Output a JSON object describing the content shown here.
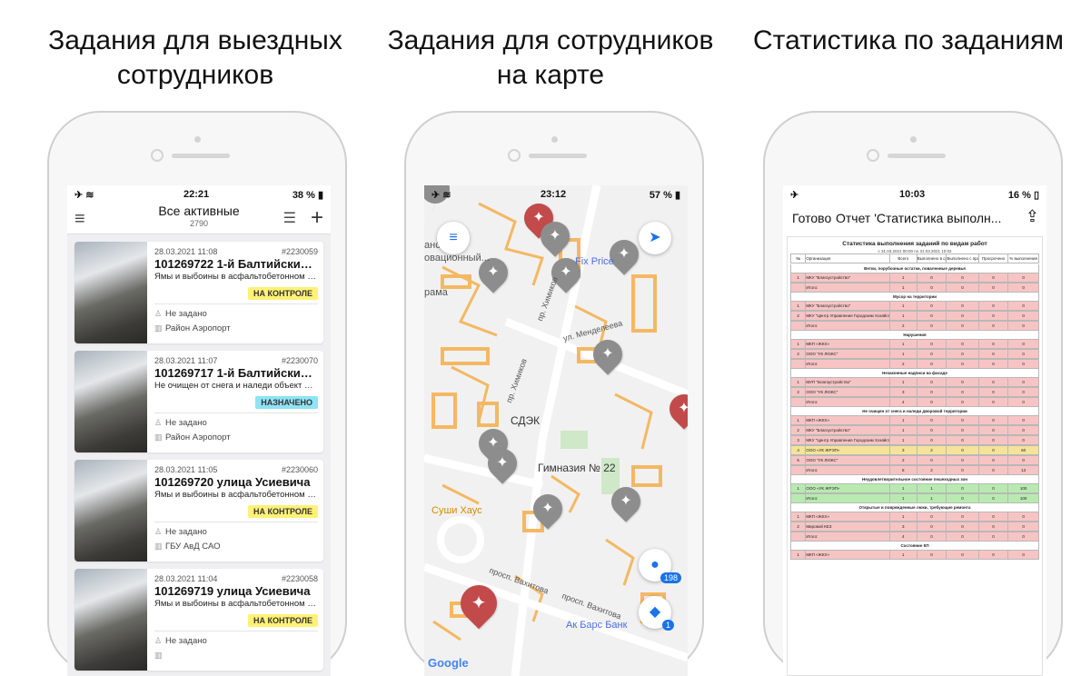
{
  "titles": {
    "left": "Задания для выездных сотрудников",
    "middle": "Задания для сотрудников на карте",
    "right": "Статистика по заданиям"
  },
  "phone1": {
    "status": {
      "time": "22:21",
      "battery": "38 %"
    },
    "header": {
      "title": "Все активные",
      "count": "2790"
    },
    "cards": [
      {
        "date": "28.03.2021 11:08",
        "number": "#2230059",
        "title": "101269722 1-й Балтийский п...",
        "desc": "Ямы и выбоины в асфальтобетонном по...",
        "badge": "НА КОНТРОЛЕ",
        "assignee": "Не задано",
        "district": "Район Аэропорт"
      },
      {
        "date": "28.03.2021 11:07",
        "number": "#2230070",
        "title": "101269717 1-й Балтийский пе...",
        "desc": "Не очищен от снега и наледи объект до...",
        "badge": "НАЗНАЧЕНО",
        "assignee": "Не задано",
        "district": "Район Аэропорт"
      },
      {
        "date": "28.03.2021 11:05",
        "number": "#2230060",
        "title": "101269720 улица Усиевича",
        "desc": "Ямы и выбоины в асфальтобетонном по...",
        "badge": "НА КОНТРОЛЕ",
        "assignee": "Не задано",
        "district": "ГБУ АвД САО"
      },
      {
        "date": "28.03.2021 11:04",
        "number": "#2230058",
        "title": "101269719 улица Усиевича",
        "desc": "Ямы и выбоины в асфальтобетонном по...",
        "badge": "НА КОНТРОЛЕ",
        "assignee": "Не задано",
        "district": ""
      }
    ],
    "colors": {
      "badge_control": "#fff176",
      "badge_assigned": "#8ee3f5"
    }
  },
  "phone2": {
    "status": {
      "time": "23:12",
      "battery": "57 %"
    },
    "labels": {
      "l1": "анс.",
      "l2": "овационный...",
      "l3": "рама",
      "l4": "Fix Price",
      "l5": "пр. Химиков",
      "l6": "ул. Менделеева",
      "l7": "пр. Химиков",
      "l8": "СДЭК",
      "l9": "Гимназия № 22",
      "l10": "Суши Хаус",
      "l11": "просп. Вахитова",
      "l12": "просп. Вахитова",
      "l13": "Ак Барс Банк",
      "google": "Google"
    },
    "counts": {
      "people": "198",
      "layers": "1"
    },
    "colors": {
      "pin_gray": "#8d8d8d",
      "pin_red": "#c24a4a",
      "road": "#f4b862",
      "accent": "#1a73e8"
    }
  },
  "phone3": {
    "status": {
      "time": "10:03",
      "battery": "16 %"
    },
    "header": {
      "done": "Готово",
      "title": "Отчет 'Статистика выполн..."
    },
    "doc": {
      "title": "Статистика выполнения заданий по видам работ",
      "period": "с 31.03.2021 00:00 по 31.03.2021 10:02",
      "columns": [
        "№",
        "Организация",
        "Всего",
        "Выполнено в срок",
        "Выполнено с просрочкой",
        "Просрочено",
        "% выполнения"
      ],
      "sections": [
        {
          "name": "Ветки, порубочные остатки, поваленные деревья",
          "color": "red",
          "rows": [
            [
              "1",
              "МКУ \"Благоустройство\"",
              "1",
              "0",
              "0",
              "0",
              "0"
            ],
            [
              "",
              "Итого:",
              "1",
              "0",
              "0",
              "0",
              "0"
            ]
          ]
        },
        {
          "name": "Мусор на территории",
          "color": "red",
          "rows": [
            [
              "1",
              "МКУ \"Благоустройство\"",
              "1",
              "0",
              "0",
              "0",
              "0"
            ],
            [
              "2",
              "МКУ \"Центр Управления Городским Хозяйством\"",
              "1",
              "0",
              "0",
              "0",
              "0"
            ],
            [
              "",
              "Итого:",
              "2",
              "0",
              "0",
              "0",
              "0"
            ]
          ]
        },
        {
          "name": "Нарушения",
          "color": "red",
          "rows": [
            [
              "1",
              "МКП «ЖКХ»",
              "1",
              "0",
              "0",
              "0",
              "0"
            ],
            [
              "2",
              "ООО \"УК ЛЮКС\"",
              "1",
              "0",
              "0",
              "0",
              "0"
            ],
            [
              "",
              "Итого:",
              "2",
              "0",
              "0",
              "0",
              "0"
            ]
          ]
        },
        {
          "name": "Незаконные надписи на фасаде",
          "color": "red",
          "rows": [
            [
              "1",
              "МУП \"Благоустройство\"",
              "1",
              "0",
              "0",
              "0",
              "0"
            ],
            [
              "2",
              "ООО \"УК ЛЮКС\"",
              "3",
              "0",
              "0",
              "0",
              "0"
            ],
            [
              "",
              "Итого:",
              "4",
              "0",
              "0",
              "0",
              "0"
            ]
          ]
        },
        {
          "name": "Не очищен от снега и наледи дворовой территории",
          "color": "mixed",
          "rows": [
            [
              "1",
              "МКП «ЖКХ»",
              "1",
              "0",
              "0",
              "0",
              "0"
            ],
            [
              "2",
              "МКУ \"Благоустройство\"",
              "1",
              "0",
              "0",
              "0",
              "0"
            ],
            [
              "3",
              "МКУ \"Центр Управления Городским Хозяйством\"",
              "1",
              "0",
              "0",
              "0",
              "0"
            ],
            [
              "4",
              "ООО «УК ЖРЭП»",
              "3",
              "2",
              "0",
              "0",
              "60"
            ],
            [
              "5",
              "ООО \"УК ЛЮКС\"",
              "2",
              "0",
              "0",
              "0",
              "0"
            ],
            [
              "",
              "Итого:",
              "8",
              "2",
              "0",
              "0",
              "13"
            ]
          ]
        },
        {
          "name": "Неудовлетворительное состояние пешеходных зон",
          "color": "green",
          "rows": [
            [
              "1",
              "ООО «УК ЖРЭП»",
              "1",
              "1",
              "0",
              "0",
              "100"
            ],
            [
              "",
              "Итого:",
              "1",
              "1",
              "0",
              "0",
              "100"
            ]
          ]
        },
        {
          "name": "Открытые и поврежденные люки, требующие ремонта",
          "color": "red",
          "rows": [
            [
              "1",
              "МКП «ЖКХ»",
              "1",
              "0",
              "0",
              "0",
              "0"
            ],
            [
              "2",
              "Мировой КЕЗ",
              "3",
              "0",
              "0",
              "0",
              "0"
            ],
            [
              "",
              "Итого:",
              "4",
              "0",
              "0",
              "0",
              "0"
            ]
          ]
        },
        {
          "name": "Состояние КП",
          "color": "red",
          "rows": [
            [
              "1",
              "МКП «ЖКХ»",
              "1",
              "0",
              "0",
              "0",
              "0"
            ]
          ]
        }
      ]
    },
    "colors": {
      "red": "#f7c4c4",
      "green": "#b8eab0",
      "yellow": "#f5e39a"
    }
  }
}
